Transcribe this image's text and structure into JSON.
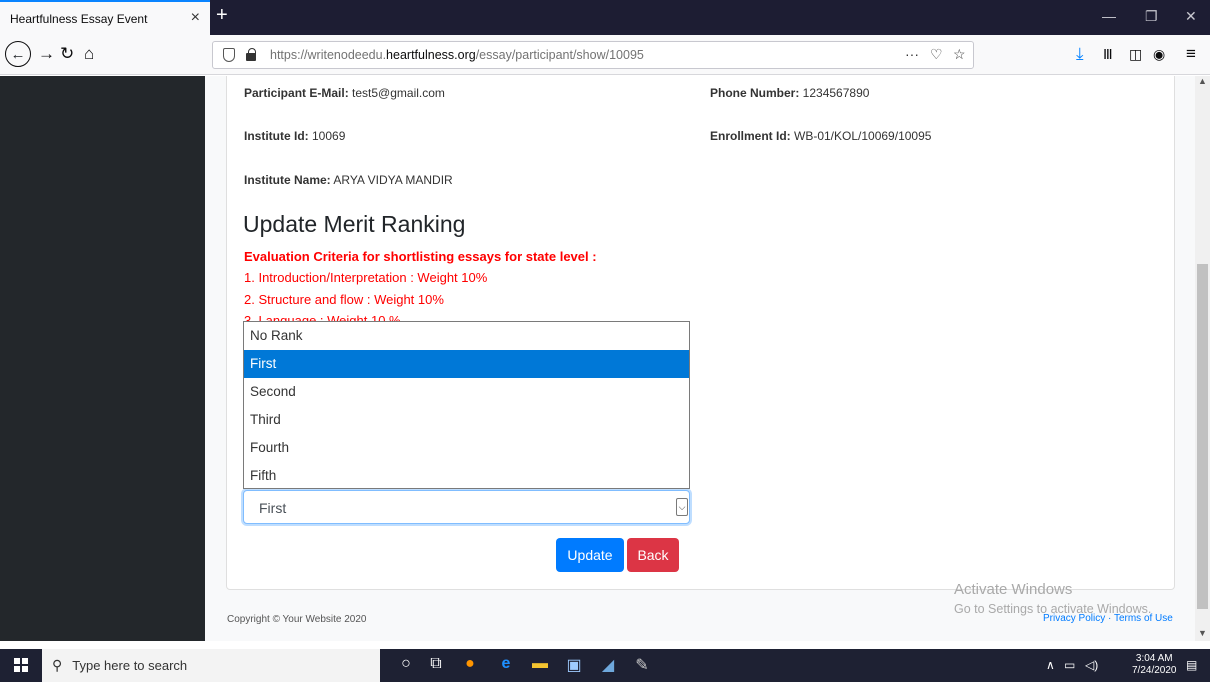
{
  "browser": {
    "tab_title": "Heartfulness Essay Event",
    "tab_close": "×",
    "new_tab": "+",
    "url_prefix": "https://writenodeedu.",
    "url_domain": "heartfulness.org",
    "url_path": "/essay/participant/show/10095",
    "url_dots": "···"
  },
  "participant": {
    "email_label": "Participant E-Mail:",
    "email_value": " test5@gmail.com",
    "phone_label": "Phone Number:",
    "phone_value": " 1234567890",
    "institute_id_label": "Institute Id:",
    "institute_id_value": " 10069",
    "enrollment_label": "Enrollment Id:",
    "enrollment_value": " WB-01/KOL/10069/10095",
    "institute_name_label": "Institute Name:",
    "institute_name_value": " ARYA VIDYA MANDIR"
  },
  "merit": {
    "heading": "Update Merit Ranking",
    "criteria_title": "Evaluation Criteria for shortlisting essays for state level :",
    "criteria": [
      "1. Introduction/Interpretation : Weight 10%",
      "2. Structure and flow : Weight 10%",
      "3. Language : Weight 10 %"
    ],
    "options": [
      "No Rank",
      "First",
      "Second",
      "Third",
      "Fourth",
      "Fifth"
    ],
    "selected": "First",
    "update_label": "Update",
    "back_label": "Back"
  },
  "footer": {
    "copyright": "Copyright © Your Website 2020",
    "links": "Privacy Policy · Terms of Use"
  },
  "watermark": {
    "line1": "Activate Windows",
    "line2": "Go to Settings to activate Windows."
  },
  "taskbar": {
    "search_placeholder": "Type here to search",
    "time": "3:04 AM",
    "date": "7/24/2020"
  },
  "colors": {
    "accent": "#007bff",
    "danger": "#dc3545",
    "criteria": "#ff0000",
    "selected_option": "#0078d7",
    "sidebar": "#23272b"
  }
}
